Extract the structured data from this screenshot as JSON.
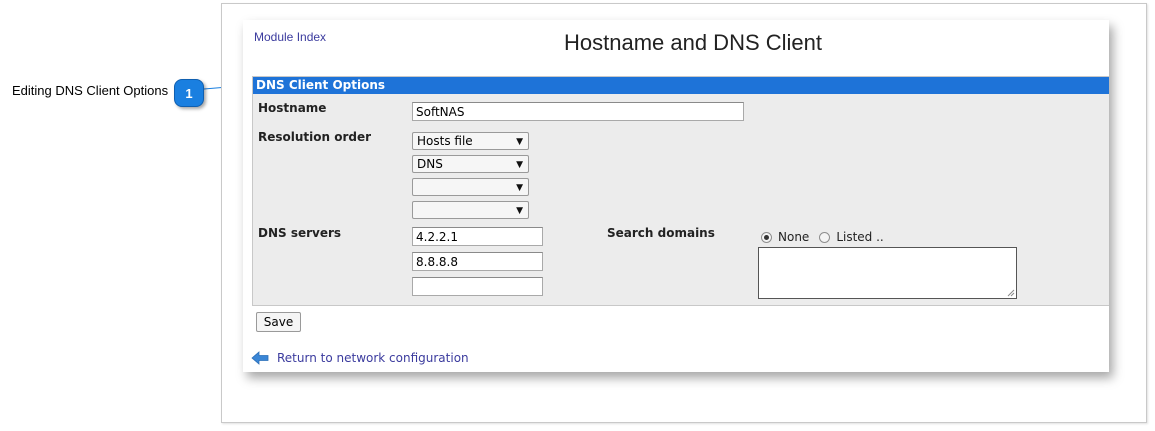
{
  "callout": {
    "label": "Editing DNS Client Options",
    "badge": "1"
  },
  "header": {
    "module_index": "Module Index",
    "title": "Hostname and DNS Client"
  },
  "section": {
    "title": "DNS Client Options"
  },
  "hostname": {
    "label": "Hostname",
    "value": "SoftNAS"
  },
  "resolution": {
    "label": "Resolution order",
    "options": [
      "Hosts file",
      "DNS",
      "",
      ""
    ]
  },
  "dns_servers": {
    "label": "DNS servers",
    "values": [
      "4.2.2.1",
      "8.8.8.8",
      ""
    ]
  },
  "search_domains": {
    "label": "Search domains",
    "option_none": "None",
    "option_listed": "Listed ..",
    "selected": "None"
  },
  "actions": {
    "save": "Save",
    "return_link": "Return to network configuration"
  },
  "colors": {
    "section_header": "#1e73d8",
    "link": "#3b3b9e",
    "badge": "#1a7fe0"
  }
}
